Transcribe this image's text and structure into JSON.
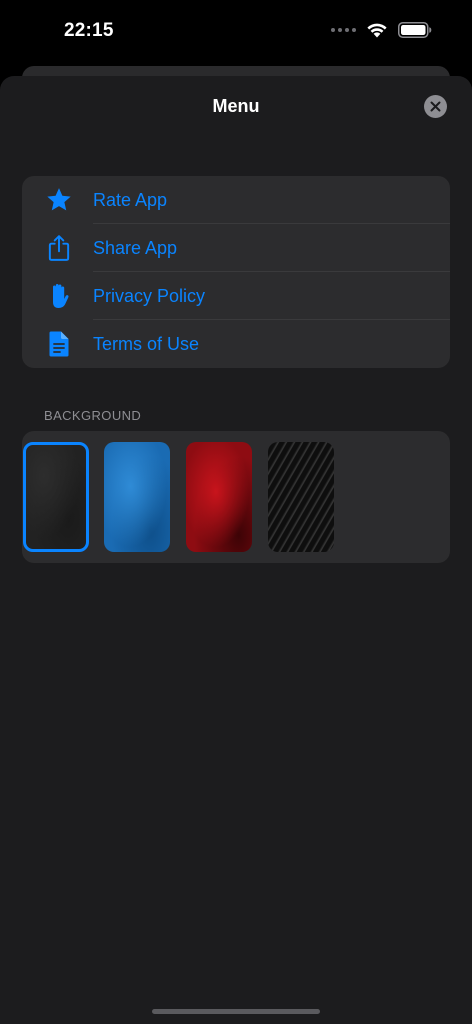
{
  "status_bar": {
    "time": "22:15"
  },
  "sheet": {
    "title": "Menu"
  },
  "menu": {
    "items": [
      {
        "label": "Rate App",
        "icon": "star-icon"
      },
      {
        "label": "Share App",
        "icon": "share-icon"
      },
      {
        "label": "Privacy Policy",
        "icon": "hand-raised-icon"
      },
      {
        "label": "Terms of Use",
        "icon": "document-icon"
      }
    ]
  },
  "background": {
    "header": "BACKGROUND",
    "swatches": [
      {
        "id": "black",
        "selected": true
      },
      {
        "id": "blue",
        "selected": false
      },
      {
        "id": "red",
        "selected": false
      },
      {
        "id": "carbon-stripes",
        "selected": false
      }
    ]
  },
  "colors": {
    "accent": "#0a84ff",
    "sheet_background": "#1c1c1e",
    "group_background": "#2c2c2e",
    "secondary_text": "#8e8e93"
  }
}
